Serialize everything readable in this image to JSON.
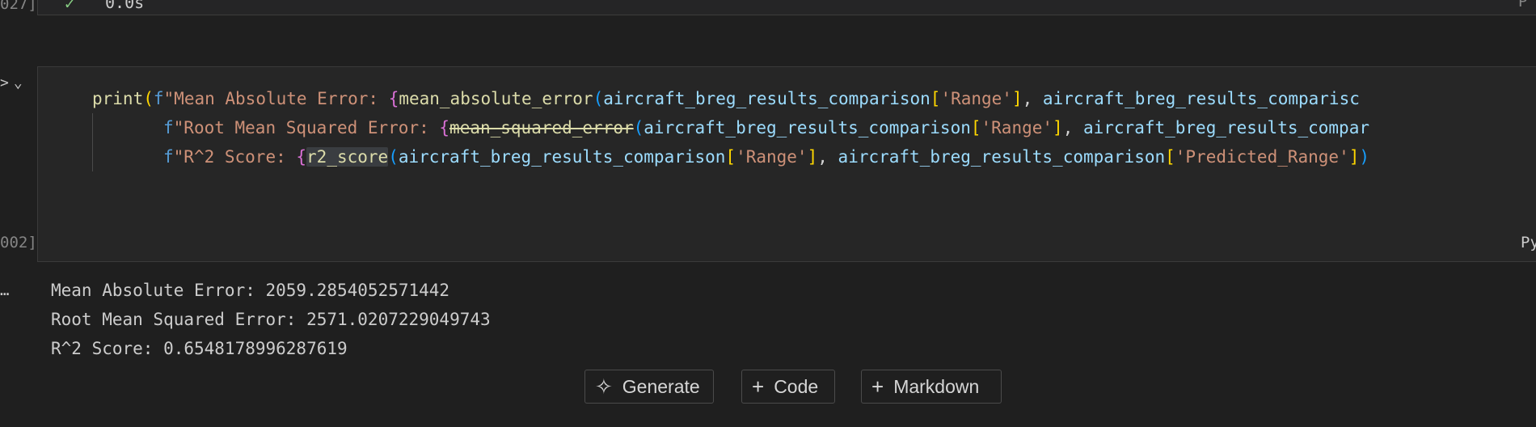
{
  "previous_cell": {
    "execution_count": "027]",
    "status_icon": "check-icon",
    "duration": "0.0s",
    "language_fragment": "P"
  },
  "cell": {
    "execution_count": "002]",
    "language_fragment": "Py",
    "run_icon": "chevron-icon",
    "code": {
      "line1": [
        {
          "t": "print",
          "c": "fn"
        },
        {
          "t": "(",
          "c": "br1"
        },
        {
          "t": "f",
          "c": "fkw"
        },
        {
          "t": "\"Mean Absolute Error: ",
          "c": "str"
        },
        {
          "t": "{",
          "c": "br2"
        },
        {
          "t": "mean_absolute_error",
          "c": "fn"
        },
        {
          "t": "(",
          "c": "br3"
        },
        {
          "t": "aircraft_breg_results_comparison",
          "c": "var"
        },
        {
          "t": "[",
          "c": "br1"
        },
        {
          "t": "'Range'",
          "c": "str"
        },
        {
          "t": "]",
          "c": "br1"
        },
        {
          "t": ", ",
          "c": "op"
        },
        {
          "t": "aircraft_breg_results_comparisc",
          "c": "var"
        }
      ],
      "line2": [
        {
          "t": "f",
          "c": "fkw"
        },
        {
          "t": "\"Root Mean Squared Error: ",
          "c": "str"
        },
        {
          "t": "{",
          "c": "br2"
        },
        {
          "t": "mean_squared_error",
          "c": "strike"
        },
        {
          "t": "(",
          "c": "br3"
        },
        {
          "t": "aircraft_breg_results_comparison",
          "c": "var"
        },
        {
          "t": "[",
          "c": "br1"
        },
        {
          "t": "'Range'",
          "c": "str"
        },
        {
          "t": "]",
          "c": "br1"
        },
        {
          "t": ", ",
          "c": "op"
        },
        {
          "t": "aircraft_breg_results_compar",
          "c": "var"
        }
      ],
      "line3": [
        {
          "t": "f",
          "c": "fkw"
        },
        {
          "t": "\"R^2 Score: ",
          "c": "str"
        },
        {
          "t": "{",
          "c": "br2"
        },
        {
          "t": "r2_score",
          "c": "fn hl"
        },
        {
          "t": "(",
          "c": "br3"
        },
        {
          "t": "aircraft_breg_results_comparison",
          "c": "var"
        },
        {
          "t": "[",
          "c": "br1"
        },
        {
          "t": "'Range'",
          "c": "str"
        },
        {
          "t": "]",
          "c": "br1"
        },
        {
          "t": ", ",
          "c": "op"
        },
        {
          "t": "aircraft_breg_results_comparison",
          "c": "var"
        },
        {
          "t": "[",
          "c": "br1"
        },
        {
          "t": "'Predicted_Range'",
          "c": "str"
        },
        {
          "t": "]",
          "c": "br1"
        },
        {
          "t": ")",
          "c": "br3"
        }
      ]
    }
  },
  "output": {
    "lines": [
      "Mean Absolute Error: 2059.2854052571442",
      "Root Mean Squared Error: 2571.0207229049743",
      "R^2 Score: 0.6548178996287619"
    ]
  },
  "toolbar": {
    "generate_label": "Generate",
    "generate_icon": "sparkle-icon",
    "code_label": "Code",
    "code_icon": "plus-icon",
    "markdown_label": "Markdown",
    "markdown_icon": "plus-icon"
  }
}
